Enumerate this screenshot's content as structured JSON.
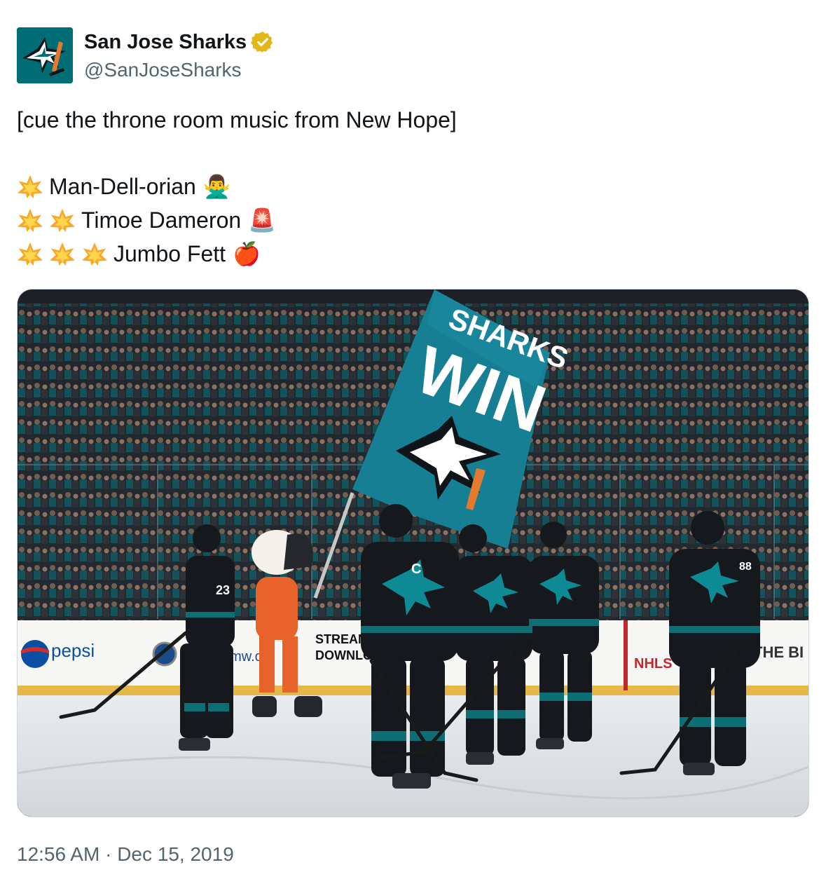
{
  "account": {
    "display_name": "San Jose Sharks",
    "handle": "@SanJoseSharks",
    "avatar_icon": "sharks-logo-icon",
    "verified_icon": "verified-badge-icon",
    "verified_color": "#e2b719",
    "brand_color": "#006d75"
  },
  "tweet": {
    "line1": "[cue the throne room music from New Hope]",
    "ranking": [
      {
        "stars": 1,
        "name": "Man-Dell-orian",
        "emoji": "🙅‍♂️",
        "emoji_name": "person-gesturing-no-icon"
      },
      {
        "stars": 2,
        "name": "Timoe Dameron",
        "emoji": "🚨",
        "emoji_name": "siren-icon"
      },
      {
        "stars": 3,
        "name": "Jumbo Fett",
        "emoji": "🍎",
        "emoji_name": "apple-icon"
      }
    ],
    "star_icon": "glowing-star-icon"
  },
  "media": {
    "flag_line1": "SHARKS",
    "flag_line2": "WIN",
    "board_pepsi": "pepsi",
    "board_stream": "STREAM Y",
    "board_download": "DOWNLOA",
    "board_bmw": "bmw.co",
    "board_nhl": "NHLS",
    "board_the": "THE BI",
    "jersey_23": "23",
    "jersey_88": "88",
    "jersey_c": "C"
  },
  "footer": {
    "time": "12:56 AM",
    "separator": "·",
    "date": "Dec 15, 2019"
  }
}
